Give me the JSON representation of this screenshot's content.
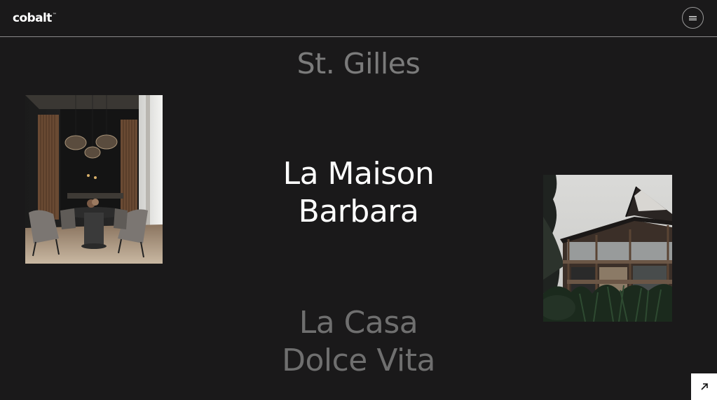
{
  "header": {
    "logo_text": "cobalt",
    "logo_mark": "™",
    "menu_icon": "hamburger-icon"
  },
  "projects": [
    {
      "lines": [
        "St. Gilles"
      ],
      "state": "previous"
    },
    {
      "lines": [
        "La Maison",
        "Barbara"
      ],
      "state": "active"
    },
    {
      "lines": [
        "La Casa",
        "Dolce Vita"
      ],
      "state": "next"
    }
  ],
  "images": {
    "left": "dining-room-interior-photo",
    "right": "modern-house-exterior-photo"
  },
  "corner_button": {
    "icon": "arrow-up-right-icon"
  },
  "colors": {
    "background": "#1a191a",
    "active_text": "#ffffff",
    "inactive_text": "#7b7b7b",
    "divider": "#8a8a8a"
  }
}
